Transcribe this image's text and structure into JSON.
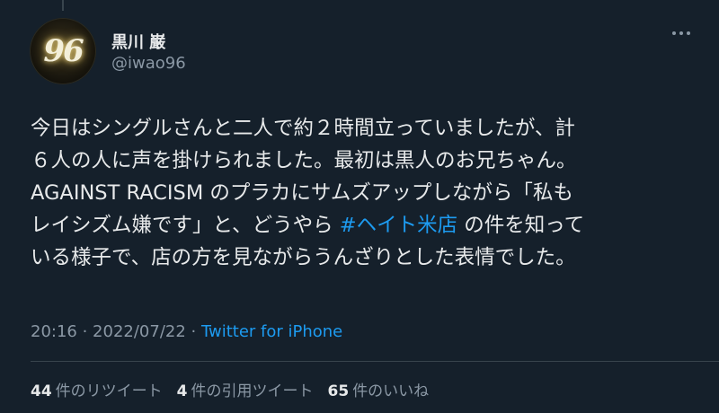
{
  "colors": {
    "background": "#15202b",
    "text": "#e7e9ea",
    "secondary": "#8b98a5",
    "link": "#1d9bf0",
    "divider": "#38444d"
  },
  "author": {
    "display_name": "黒川 巌",
    "handle": "@iwao96",
    "avatar_text": "96"
  },
  "more_icon": "more-horizontal-icon",
  "tweet": {
    "lines": [
      {
        "before": "今日はシングルさんと二人で約２時間立っていましたが、計",
        "hashtag": "",
        "after": ""
      },
      {
        "before": "６人の人に声を掛けられました。最初は黒人のお兄ちゃん。",
        "hashtag": "",
        "after": ""
      },
      {
        "before": "AGAINST RACISM のプラカにサムズアップしながら「私も",
        "hashtag": "",
        "after": ""
      },
      {
        "before": "レイシズム嫌です」と、どうやら ",
        "hashtag": "#ヘイト米店",
        "after": " の件を知って"
      },
      {
        "before": "いる様子で、店の方を見ながらうんざりとした表情でした。",
        "hashtag": "",
        "after": ""
      }
    ]
  },
  "meta": {
    "time": "20:16",
    "separator": " · ",
    "date": "2022/07/22",
    "source": "Twitter for iPhone"
  },
  "stats": {
    "retweets_count": "44",
    "retweets_label": "件のリツイート",
    "quotes_count": "4",
    "quotes_label": "件の引用ツイート",
    "likes_count": "65",
    "likes_label": "件のいいね"
  }
}
